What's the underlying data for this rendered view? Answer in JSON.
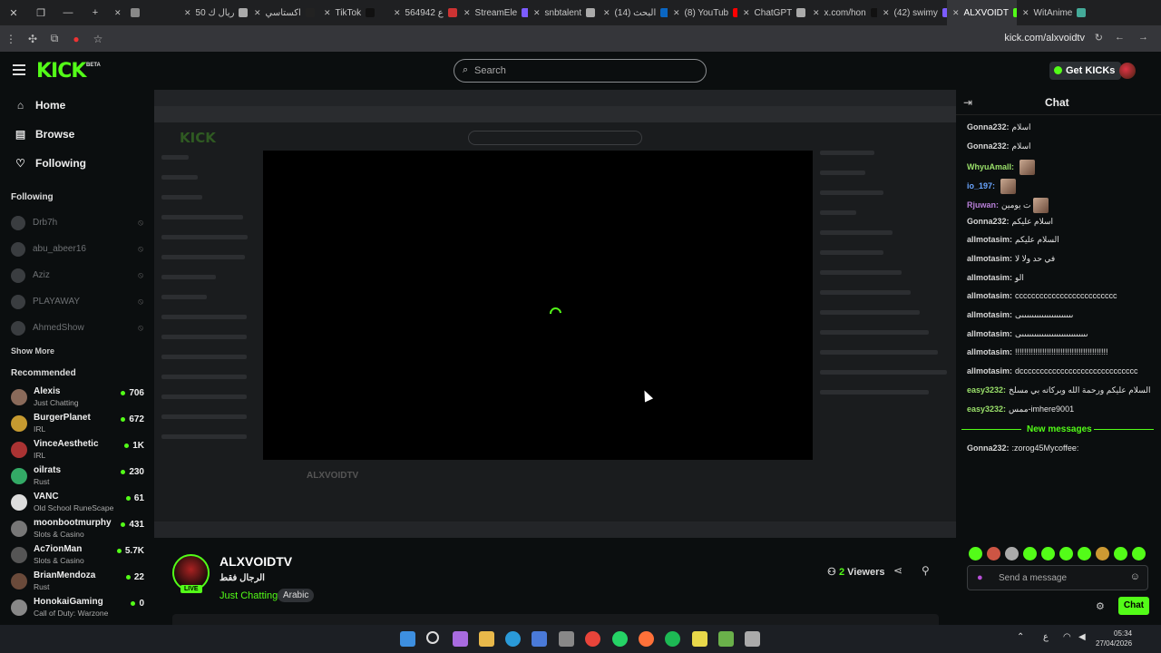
{
  "browser": {
    "tabs": [
      {
        "label": "",
        "color": "#888"
      },
      {
        "label": "50 ريال ك",
        "color": "#aaa"
      },
      {
        "label": "اكستاسي",
        "color": "#222"
      },
      {
        "label": "TikTok",
        "color": "#111"
      },
      {
        "label": "564942 ع",
        "color": "#c33"
      },
      {
        "label": "StreamEle",
        "color": "#7c5cff"
      },
      {
        "label": "snbtalent",
        "color": "#aaa"
      },
      {
        "label": "(14) البحث",
        "color": "#0a66c2"
      },
      {
        "label": "(8) YouTub",
        "color": "#f00"
      },
      {
        "label": "ChatGPT",
        "color": "#aaa"
      },
      {
        "label": "x.com/hon",
        "color": "#111"
      },
      {
        "label": "(42) swimy",
        "color": "#7c5cff"
      },
      {
        "label": "ALXVOIDT",
        "color": "#53fc18"
      },
      {
        "label": "WitAnime",
        "color": "#4a9"
      }
    ],
    "url": "kick.com/alxvoidtv"
  },
  "header": {
    "logo": "KICK",
    "beta": "BETA",
    "search_placeholder": "Search",
    "get_kicks": "Get KICKs"
  },
  "sidebar": {
    "nav": [
      {
        "label": "Home",
        "icon": "home-icon"
      },
      {
        "label": "Browse",
        "icon": "browse-icon"
      },
      {
        "label": "Following",
        "icon": "heart-icon"
      }
    ],
    "following_title": "Following",
    "following": [
      "Drb7h",
      "abu_abeer16",
      "Aziz",
      "PLAYAWAY",
      "AhmedShow"
    ],
    "show_more": "Show More",
    "recommended_title": "Recommended",
    "recommended": [
      {
        "name": "Alexis",
        "category": "Just Chatting",
        "viewers": "706",
        "color": "#8a6a5a"
      },
      {
        "name": "BurgerPlanet",
        "category": "IRL",
        "viewers": "672",
        "color": "#c69a30"
      },
      {
        "name": "VinceAesthetic",
        "category": "IRL",
        "viewers": "1K",
        "color": "#a33"
      },
      {
        "name": "oilrats",
        "category": "Rust",
        "viewers": "230",
        "color": "#3a6"
      },
      {
        "name": "VANC",
        "category": "Old School RuneScape",
        "viewers": "61",
        "color": "#ddd"
      },
      {
        "name": "moonbootmurphy",
        "category": "Slots & Casino",
        "viewers": "431",
        "color": "#777"
      },
      {
        "name": "Ac7ionMan",
        "category": "Slots & Casino",
        "viewers": "5.7K",
        "color": "#555"
      },
      {
        "name": "BrianMendoza",
        "category": "Rust",
        "viewers": "22",
        "color": "#6a4a3a"
      },
      {
        "name": "HonokaiGaming",
        "category": "Call of Duty: Warzone",
        "viewers": "0",
        "color": "#888"
      }
    ]
  },
  "stream": {
    "channel": "ALXVOIDTV",
    "title": "الرجال فقط",
    "category": "Just Chatting",
    "tag": "Arabic",
    "live": "LIVE",
    "viewers_count": "2",
    "viewers_label": "Viewers"
  },
  "chat": {
    "title": "Chat",
    "messages": [
      {
        "user": "Gonna232:",
        "text": "اسلام",
        "color": "#d7d7d7",
        "emote": false
      },
      {
        "user": "Gonna232:",
        "text": "اسلام",
        "color": "#d7d7d7",
        "emote": false
      },
      {
        "user": "WhyuAmalI:",
        "text": "",
        "color": "#9ae06a",
        "emote": true
      },
      {
        "user": "io_197:",
        "text": "",
        "color": "#6aa5ff",
        "emote": true
      },
      {
        "user": "Rjuwan:",
        "text": "ت يومين",
        "color": "#b77fd8",
        "emote": true
      },
      {
        "user": "Gonna232:",
        "text": "اسلام عليكم",
        "color": "#d7d7d7",
        "emote": false
      },
      {
        "user": "allmotasim:",
        "text": "السلام عليكم",
        "color": "#d7d7d7",
        "emote": false
      },
      {
        "user": "allmotasim:",
        "text": "في حد ولا لا",
        "color": "#d7d7d7",
        "emote": false
      },
      {
        "user": "allmotasim:",
        "text": "الو",
        "color": "#d7d7d7",
        "emote": false
      },
      {
        "user": "allmotasim:",
        "text": "ccccccccccccccccccccccccc",
        "color": "#d7d7d7",
        "emote": false
      },
      {
        "user": "allmotasim:",
        "text": "ىىىىىىىىىىىىىىىىىىىىىى",
        "color": "#d7d7d7",
        "emote": false
      },
      {
        "user": "allmotasim:",
        "text": "ىىىىىىىىىىىىىىىىىىىىىىىىىىىى",
        "color": "#d7d7d7",
        "emote": false
      },
      {
        "user": "allmotasim:",
        "text": "!!!!!!!!!!!!!!!!!!!!!!!!!!!!!!!!!!!!!!!!!",
        "color": "#d7d7d7",
        "emote": false
      },
      {
        "user": "allmotasim:",
        "text": "dccccccccccccccccccccccccccccc",
        "color": "#d7d7d7",
        "emote": false
      },
      {
        "user": "easy3232:",
        "text": "السلام عليكم ورحمة الله وبركاته بي مسلخ",
        "color": "#9ae06a",
        "emote": false
      },
      {
        "user": "easy3232:",
        "text": "ممس-imhere9001",
        "color": "#9ae06a",
        "emote": false
      }
    ],
    "new_messages": "New messages",
    "last_message": {
      "user": "Gonna232:",
      "text": ":zorog45Mycoffee:",
      "color": "#d7d7d7"
    },
    "input_placeholder": "Send a message",
    "send": "Chat"
  },
  "system": {
    "time": "05:34",
    "date": "27/04/2026",
    "lang": "ع"
  }
}
